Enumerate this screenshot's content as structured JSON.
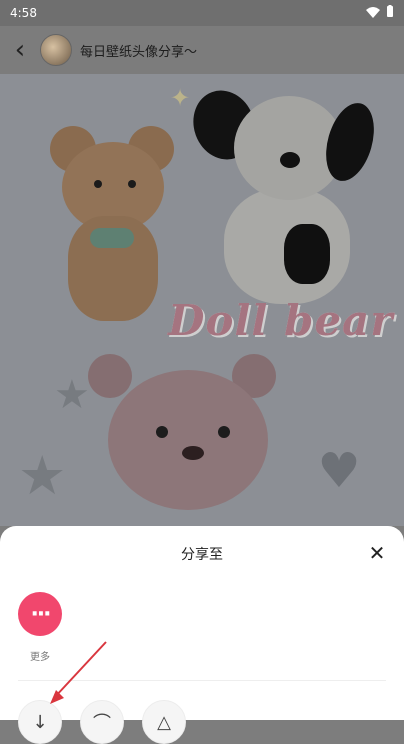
{
  "status": {
    "time": "4:58"
  },
  "header": {
    "title": "每日壁纸头像分享～"
  },
  "image": {
    "text": "Doll bear"
  },
  "sheet": {
    "title": "分享至",
    "more_label": "更多",
    "more_glyph": "···"
  },
  "colors": {
    "accent": "#f1476d",
    "overlay": "#7d7d7d",
    "arrow": "#d9363e"
  },
  "icons": {
    "back": "back-icon",
    "close": "close-icon",
    "more": "more-icon",
    "download": "download-icon",
    "link": "link-icon",
    "warning": "warning-icon"
  }
}
